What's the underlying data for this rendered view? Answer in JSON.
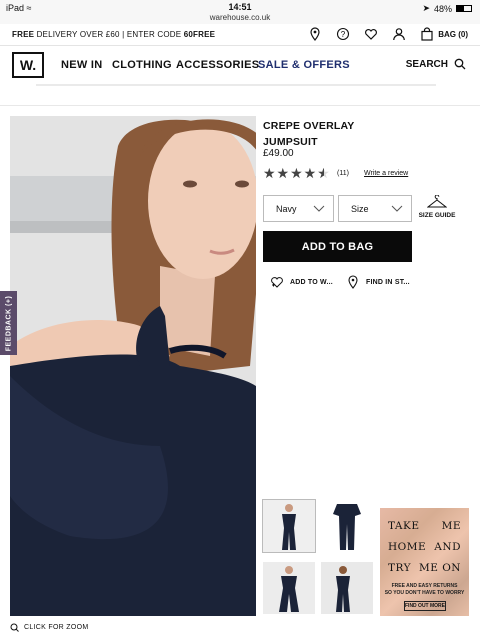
{
  "status_bar": {
    "device": "iPad",
    "time": "14:51",
    "url": "warehouse.co.uk",
    "battery": "48%"
  },
  "promo_bar": {
    "free_word": "FREE",
    "delivery_text": " DELIVERY OVER £60 | ENTER CODE ",
    "code": "60FREE",
    "bag_label": "BAG (0)"
  },
  "nav": {
    "logo": "W.",
    "items": [
      "NEW IN",
      "CLOTHING",
      "ACCESSORIES",
      "SALE & OFFERS"
    ],
    "search_label": "SEARCH"
  },
  "feedback_tab": "FEEDBACK (+)",
  "zoom_label": "CLICK FOR ZOOM",
  "product": {
    "title_line1": "CREPE OVERLAY",
    "title_line2": "JUMPSUIT",
    "price": "£49.00",
    "rating_fraction": 0.9,
    "review_count": "(11)",
    "write_review": "Write a review",
    "colour_selected": "Navy",
    "size_placeholder": "Size",
    "size_guide": "SIZE GUIDE",
    "add_to_bag": "ADD TO BAG",
    "add_to_wishlist": "ADD TO W...",
    "find_in_store": "FIND IN ST..."
  },
  "promo_tile": {
    "line1_a": "TAKE",
    "line1_b": "ME",
    "line2_a": "HOME",
    "line2_b": "AND",
    "line3_a": "TRY",
    "line3_b": "ME ON",
    "small1": "FREE AND EASY RETURNS",
    "small2": "SO YOU DON'T HAVE TO WORRY",
    "cta": "FIND OUT MORE"
  },
  "colors": {
    "navy": "#1b2338",
    "sale_text": "#1f2e6e",
    "feedback_bg": "#5b4b6a",
    "button_bg": "#0a0a0a"
  }
}
